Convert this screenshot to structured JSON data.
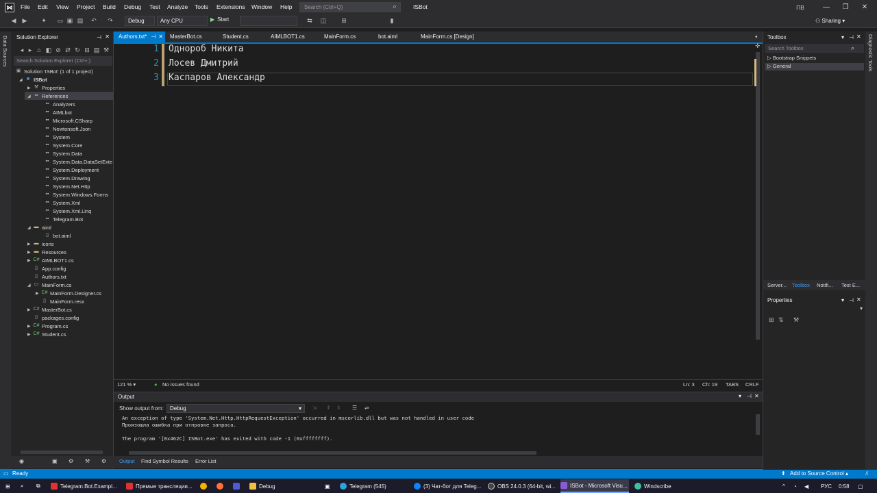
{
  "menu": [
    "File",
    "Edit",
    "View",
    "Project",
    "Build",
    "Debug",
    "Test",
    "Analyze",
    "Tools",
    "Extensions",
    "Window",
    "Help"
  ],
  "search_placeholder": "Search (Ctrl+Q)",
  "solution_name": "ISBot",
  "user_initials": "ПВ",
  "toolbar": {
    "config": "Debug",
    "platform": "Any CPU",
    "start_label": "Start",
    "sharing_label": "Sharing"
  },
  "left_strip_label": "Data Sources",
  "right_strip_label": "Diagnostic Tools",
  "solution_explorer": {
    "title": "Solution Explorer",
    "search_placeholder": "Search Solution Explorer (Ctrl+;)",
    "items": [
      {
        "label": "Solution 'ISBot' (1 of 1 project)"
      },
      {
        "label": "ISBot"
      },
      {
        "label": "Properties"
      },
      {
        "label": "References"
      },
      {
        "label": "Analyzers"
      },
      {
        "label": "AIMLbot"
      },
      {
        "label": "Microsoft.CSharp"
      },
      {
        "label": "Newtonsoft.Json"
      },
      {
        "label": "System"
      },
      {
        "label": "System.Core"
      },
      {
        "label": "System.Data"
      },
      {
        "label": "System.Data.DataSetExte"
      },
      {
        "label": "System.Deployment"
      },
      {
        "label": "System.Drawing"
      },
      {
        "label": "System.Net.Http"
      },
      {
        "label": "System.Windows.Forms"
      },
      {
        "label": "System.Xml"
      },
      {
        "label": "System.Xml.Linq"
      },
      {
        "label": "Telegram.Bot"
      },
      {
        "label": "aiml"
      },
      {
        "label": "bot.aiml"
      },
      {
        "label": "icons"
      },
      {
        "label": "Resources"
      },
      {
        "label": "AIMLBOT1.cs"
      },
      {
        "label": "App.config"
      },
      {
        "label": "Authors.txt"
      },
      {
        "label": "MainForm.cs"
      },
      {
        "label": "MainForm.Designer.cs"
      },
      {
        "label": "MainForm.resx"
      },
      {
        "label": "MasterBot.cs"
      },
      {
        "label": "packages.config"
      },
      {
        "label": "Program.cs"
      },
      {
        "label": "Student.cs"
      }
    ]
  },
  "tabs": [
    {
      "label": "Authors.txt*"
    },
    {
      "label": "MasterBot.cs"
    },
    {
      "label": "Student.cs"
    },
    {
      "label": "AIMLBOT1.cs"
    },
    {
      "label": "MainForm.cs"
    },
    {
      "label": "bot.aiml"
    },
    {
      "label": "MainForm.cs [Design]"
    }
  ],
  "editor": {
    "lines": [
      {
        "num": "1",
        "text": "Однороб Никита"
      },
      {
        "num": "2",
        "text": "Лосев Дмитрий"
      },
      {
        "num": "3",
        "text": "Каспаров Александр"
      }
    ],
    "zoom": "121 %",
    "issues": "No issues found",
    "position": "Ln: 3",
    "column": "Ch: 19",
    "indent": "TABS",
    "eol": "CRLF"
  },
  "output": {
    "title": "Output",
    "source_label": "Show output from:",
    "source_value": "Debug",
    "lines": [
      "An exception of type 'System.Net.Http.HttpRequestException' occurred in mscorlib.dll but was not handled in user code",
      "Произошла ошибка при отправке запроса.",
      "",
      "The program '[0x462C] ISBot.exe' has exited with code -1 (0xffffffff)."
    ]
  },
  "bottom_tabs": [
    "Output",
    "Find Symbol Results",
    "Error List"
  ],
  "status": {
    "ready": "Ready",
    "source_control": "Add to Source Control"
  },
  "toolbox": {
    "title": "Toolbox",
    "search_placeholder": "Search Toolbox",
    "groups": [
      "Bootstrap Snippets",
      "General"
    ]
  },
  "right_tabs": [
    "Server...",
    "Toolbox",
    "Notifi...",
    "Test E..."
  ],
  "properties": {
    "title": "Properties"
  },
  "taskbar": {
    "items": [
      {
        "label": "Telegram.Bot.Exampl..."
      },
      {
        "label": "Прямые трансляции..."
      },
      {
        "label": "Debug"
      },
      {
        "label": "Telegram (545)"
      },
      {
        "label": "(3) Чат-бот для Teleg..."
      },
      {
        "label": "OBS 24.0.3 (64-bit, wi..."
      },
      {
        "label": "ISBot - Microsoft Visu..."
      },
      {
        "label": "Windscribe"
      }
    ],
    "lang": "РУС",
    "time": "0:58"
  },
  "colors": {
    "accent": "#007acc",
    "line_number": "#2b91af",
    "editor_bg": "#1e1e1e"
  }
}
